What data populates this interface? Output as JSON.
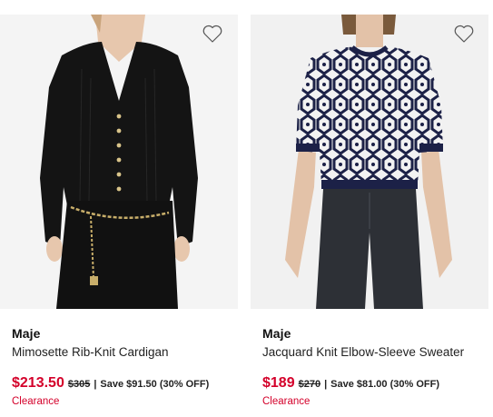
{
  "products": [
    {
      "brand": "Maje",
      "name": "Mimosette Rib-Knit Cardigan",
      "sale_price": "$213.50",
      "original_price": "$305",
      "separator": "|",
      "savings": "Save $91.50 (30% OFF)",
      "badge": "Clearance",
      "image_icon": "product-image-black-cardigan",
      "favorite_icon": "heart-outline-icon"
    },
    {
      "brand": "Maje",
      "name": "Jacquard Knit Elbow-Sleeve Sweater",
      "sale_price": "$189",
      "original_price": "$270",
      "separator": "|",
      "savings": "Save $81.00 (30% OFF)",
      "badge": "Clearance",
      "image_icon": "product-image-jacquard-sweater",
      "favorite_icon": "heart-outline-icon"
    }
  ],
  "colors": {
    "sale_red": "#d4002a",
    "text_dark": "#111111"
  }
}
